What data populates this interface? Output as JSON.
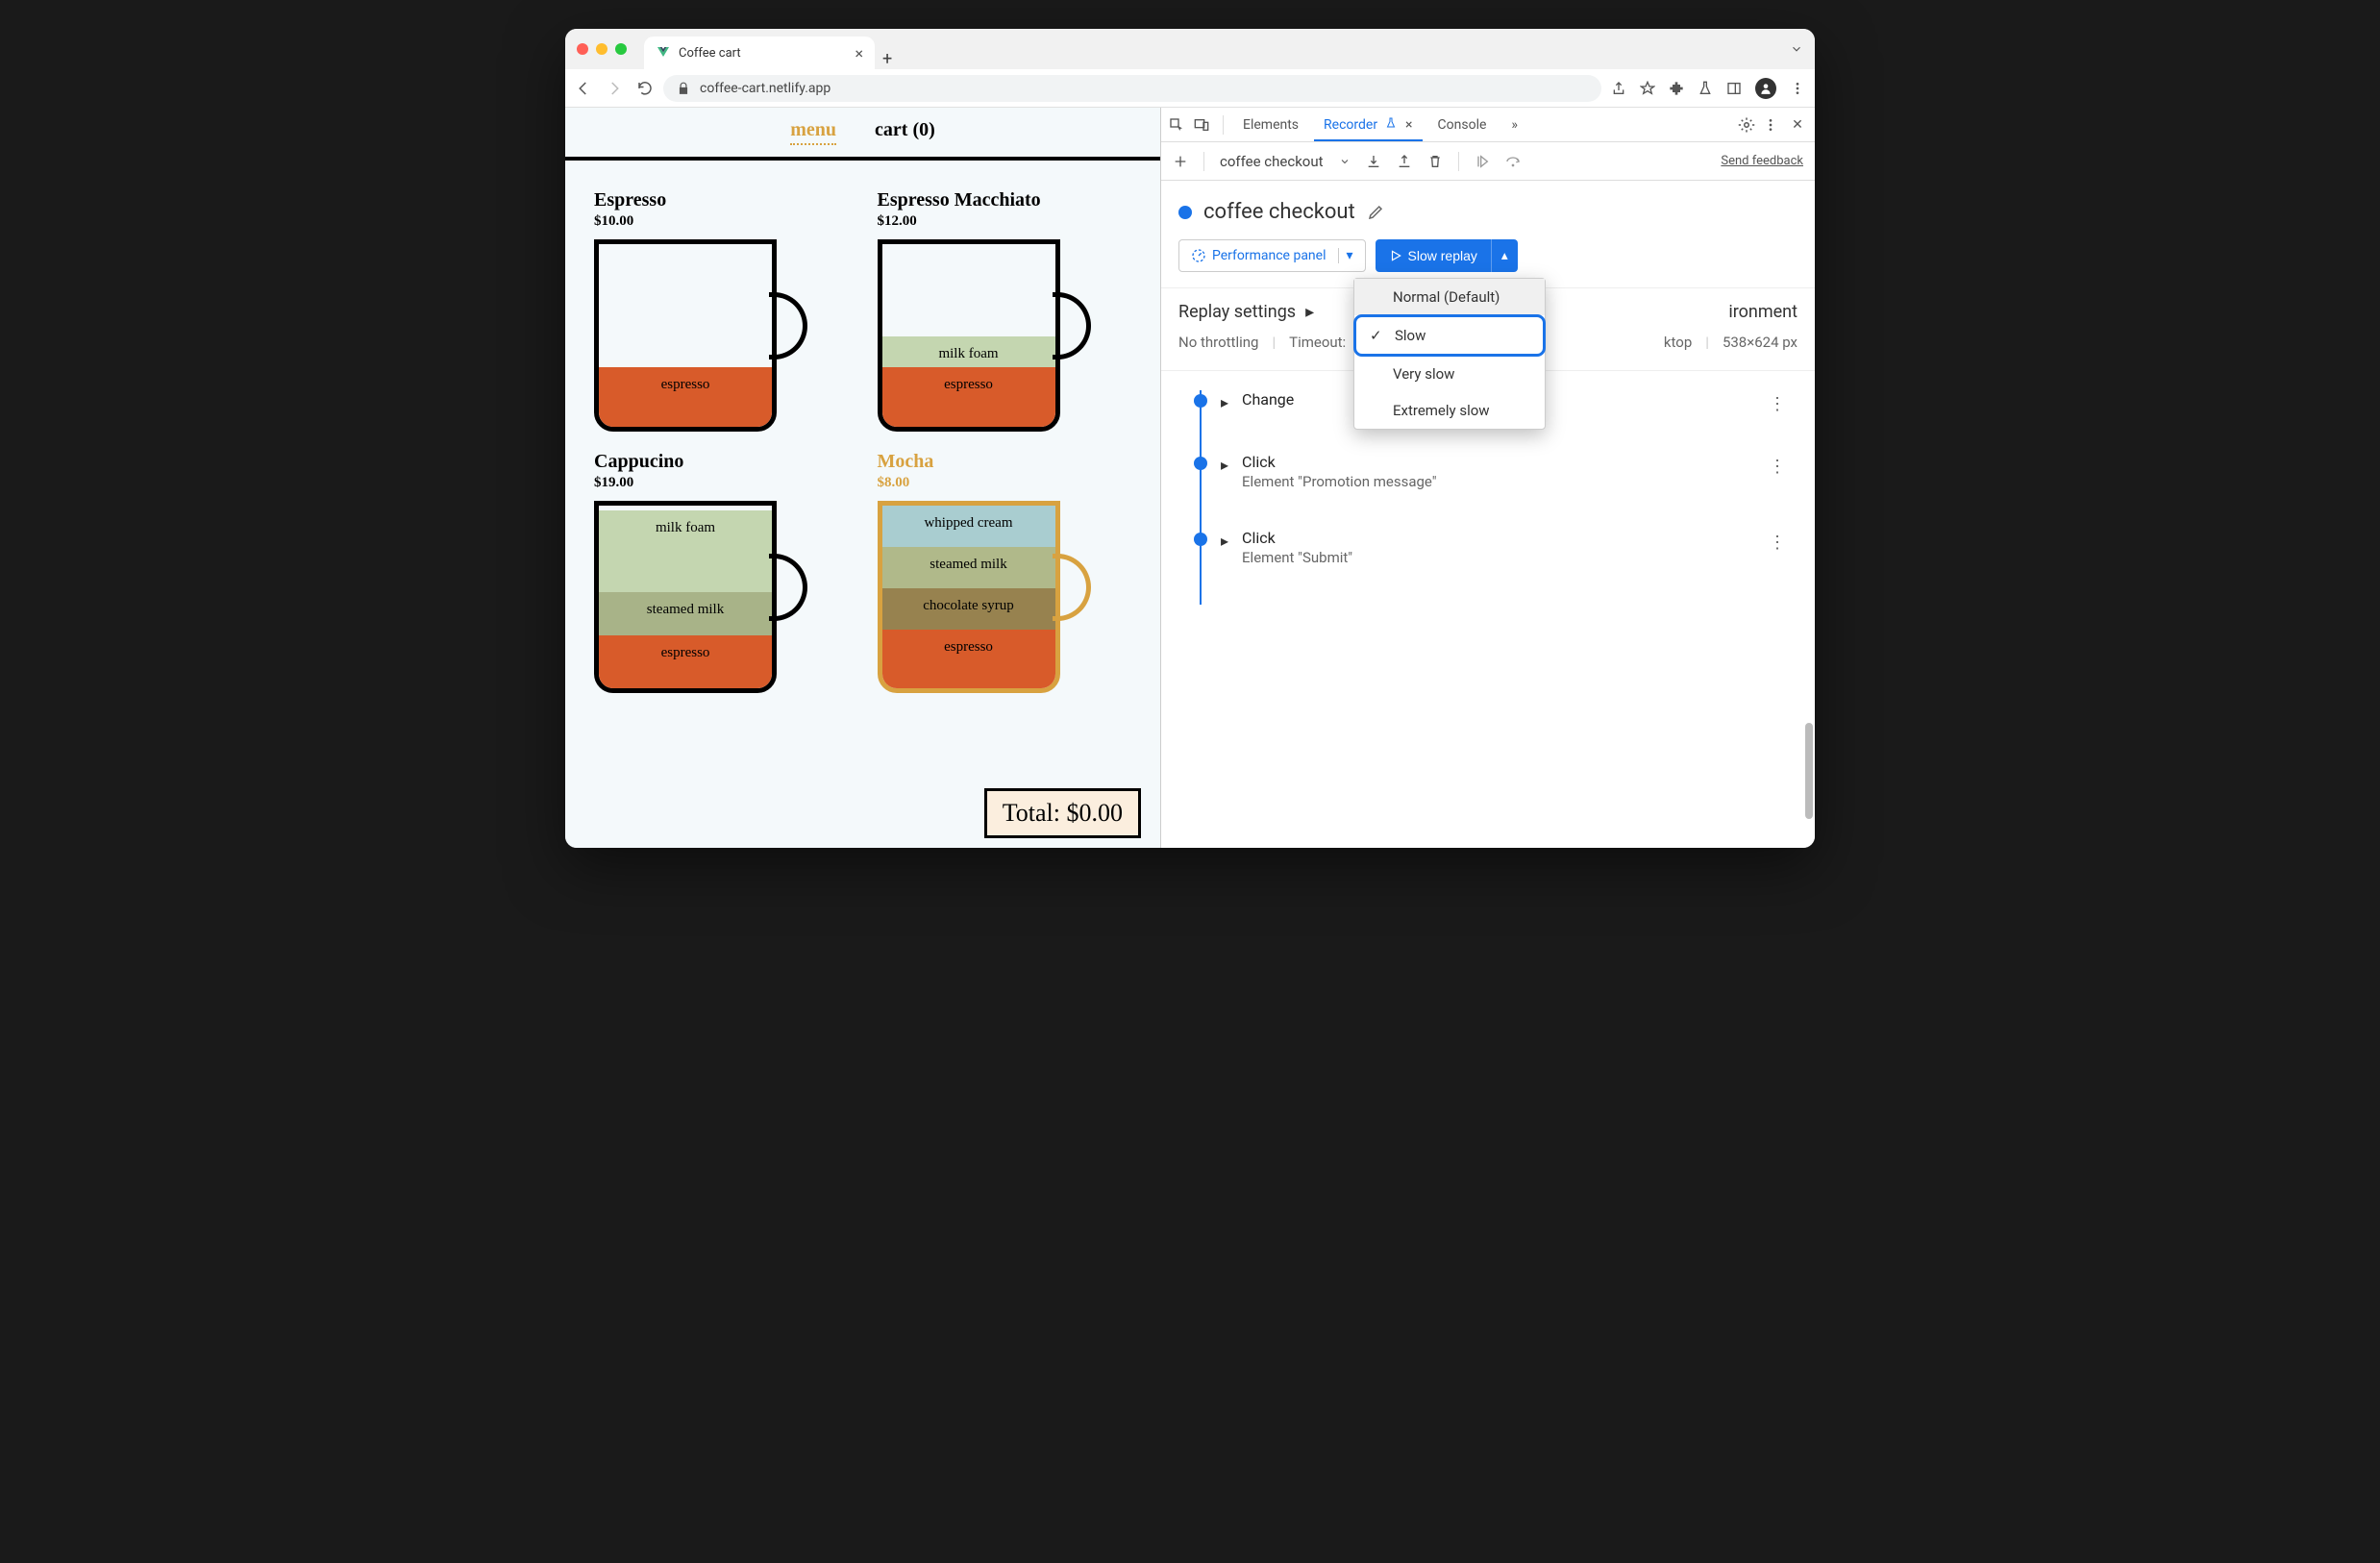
{
  "browser": {
    "tab_title": "Coffee cart",
    "url": "coffee-cart.netlify.app"
  },
  "page": {
    "nav": {
      "menu": "menu",
      "cart": "cart (0)"
    },
    "products": [
      {
        "name": "Espresso",
        "price": "$10.00",
        "layers": [
          "espresso"
        ]
      },
      {
        "name": "Espresso Macchiato",
        "price": "$12.00",
        "layers": [
          "milk foam",
          "espresso"
        ]
      },
      {
        "name": "Cappucino",
        "price": "$19.00",
        "layers": [
          "milk foam",
          "steamed milk",
          "espresso"
        ]
      },
      {
        "name": "Mocha",
        "price": "$8.00",
        "layers": [
          "whipped cream",
          "steamed milk",
          "chocolate syrup",
          "espresso"
        ]
      }
    ],
    "total": "Total: $0.00"
  },
  "devtools": {
    "tabs": {
      "elements": "Elements",
      "recorder": "Recorder",
      "console": "Console"
    },
    "toolbar": {
      "recording_name": "coffee checkout",
      "feedback": "Send feedback"
    },
    "heading": "coffee checkout",
    "perf_button": "Performance panel",
    "replay_button": "Slow replay",
    "replay_menu": {
      "normal": "Normal (Default)",
      "slow": "Slow",
      "very_slow": "Very slow",
      "extremely_slow": "Extremely slow"
    },
    "settings": {
      "replay_label": "Replay settings",
      "env_label": "ironment",
      "throttling": "No throttling",
      "timeout": "Timeout:",
      "device": "ktop",
      "viewport": "538×624 px"
    },
    "timeline": [
      {
        "title": "Change",
        "sub": ""
      },
      {
        "title": "Click",
        "sub": "Element \"Promotion message\""
      },
      {
        "title": "Click",
        "sub": "Element \"Submit\""
      }
    ]
  }
}
